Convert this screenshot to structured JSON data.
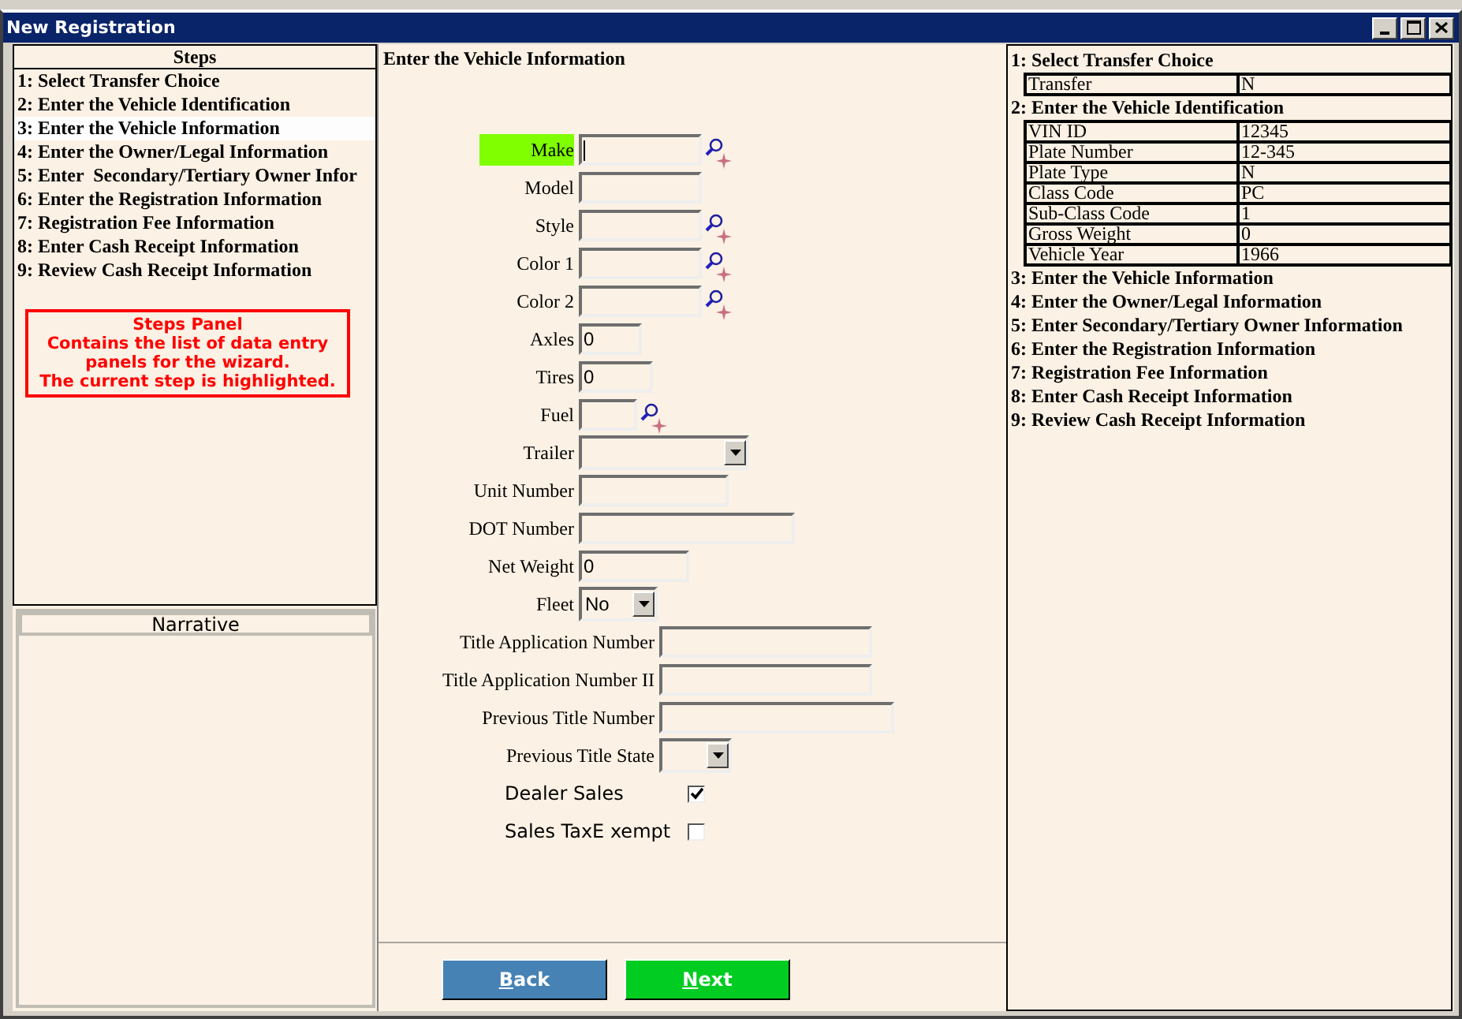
{
  "window": {
    "title": "New Registration"
  },
  "steps_panel": {
    "header": "Steps",
    "items": [
      {
        "label": "1: Select Transfer Choice",
        "selected": false
      },
      {
        "label": "2: Enter the Vehicle Identification",
        "selected": false
      },
      {
        "label": "3: Enter the Vehicle Information",
        "selected": true
      },
      {
        "label": "4: Enter the Owner/Legal Information",
        "selected": false
      },
      {
        "label": "5: Enter  Secondary/Tertiary Owner Infor",
        "selected": false
      },
      {
        "label": "6: Enter the Registration Information",
        "selected": false
      },
      {
        "label": "7: Registration Fee Information",
        "selected": false
      },
      {
        "label": "8: Enter Cash Receipt Information",
        "selected": false
      },
      {
        "label": "9: Review Cash Receipt Information",
        "selected": false
      }
    ],
    "annotation": {
      "title": "Steps Panel",
      "text": "Contains the list of data entry\npanels for the wizard.\nThe current step is highlighted."
    }
  },
  "narrative": {
    "header": "Narrative"
  },
  "form": {
    "heading": "Enter the Vehicle Information",
    "fields": [
      {
        "kind": "text",
        "label": "Make",
        "lookup": true,
        "focused": true
      },
      {
        "kind": "text",
        "label": "Model",
        "lookup": false,
        "focused": false
      },
      {
        "kind": "text",
        "label": "Style",
        "lookup": true,
        "focused": false
      },
      {
        "kind": "text",
        "label": "Color 1",
        "lookup": true,
        "focused": false
      },
      {
        "kind": "text",
        "label": "Color 2",
        "lookup": true,
        "focused": false
      },
      {
        "kind": "text",
        "label": "Axles",
        "value": "0",
        "lookup": false,
        "focused": false
      },
      {
        "kind": "text",
        "label": "Tires",
        "value": "0",
        "lookup": false,
        "focused": false
      },
      {
        "kind": "text",
        "label": "Fuel",
        "lookup": true,
        "focused": false
      },
      {
        "kind": "select",
        "label": "Trailer",
        "focused": false
      },
      {
        "kind": "text",
        "label": "Unit Number",
        "lookup": false,
        "focused": false
      },
      {
        "kind": "text",
        "label": "DOT Number",
        "lookup": false,
        "focused": false
      },
      {
        "kind": "text",
        "label": "Net Weight",
        "value": "0",
        "lookup": false,
        "focused": false
      },
      {
        "kind": "select",
        "label": "Fleet",
        "value": "No",
        "focused": false
      },
      {
        "kind": "text",
        "label": "Title Application Number",
        "lookup": false,
        "focused": false
      },
      {
        "kind": "text",
        "label": "Title Application Number II",
        "lookup": false,
        "focused": false
      },
      {
        "kind": "text",
        "label": "Previous Title Number",
        "lookup": false,
        "focused": false
      },
      {
        "kind": "select",
        "label": "Previous Title State",
        "focused": false
      },
      {
        "kind": "checkbox",
        "label": "Dealer Sales",
        "checked": true
      },
      {
        "kind": "checkbox",
        "label": "Sales TaxE xempt",
        "checked": false
      }
    ]
  },
  "buttons": [
    {
      "kind": "back",
      "label": "Back"
    },
    {
      "kind": "next",
      "label": "Next"
    }
  ],
  "summary": {
    "sections": [
      {
        "title": "1: Select Transfer Choice",
        "rows": [
          {
            "label": "Transfer",
            "value": "N"
          }
        ]
      },
      {
        "title": "2: Enter the Vehicle Identification",
        "rows": [
          {
            "label": "VIN ID",
            "value": "12345"
          },
          {
            "label": "Plate Number",
            "value": "12-345"
          },
          {
            "label": "Plate Type",
            "value": "N"
          },
          {
            "label": "Class Code",
            "value": "PC"
          },
          {
            "label": "Sub-Class Code",
            "value": "1"
          },
          {
            "label": "Gross Weight",
            "value": "0"
          },
          {
            "label": "Vehicle Year",
            "value": "1966"
          }
        ]
      },
      {
        "title": "3: Enter the Vehicle Information"
      },
      {
        "title": "4: Enter the Owner/Legal Information"
      },
      {
        "title": "5: Enter Secondary/Tertiary Owner Information"
      },
      {
        "title": "6: Enter the Registration Information"
      },
      {
        "title": "7: Registration Fee Information"
      },
      {
        "title": "8: Enter Cash Receipt Information"
      },
      {
        "title": "9: Review Cash Receipt Information"
      }
    ]
  }
}
